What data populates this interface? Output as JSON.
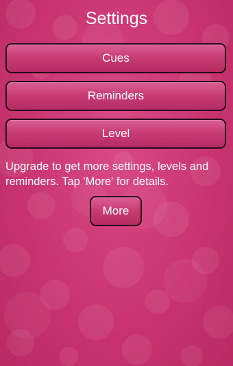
{
  "header": {
    "title": "Settings"
  },
  "menu": {
    "cues_label": "Cues",
    "reminders_label": "Reminders",
    "level_label": "Level"
  },
  "upgrade": {
    "message": "Upgrade to get more settings, levels and reminders. Tap 'More' for details.",
    "more_label": "More"
  },
  "theme": {
    "background": "#c8336f",
    "button_border": "#2b0a19",
    "text": "#ffffff"
  }
}
